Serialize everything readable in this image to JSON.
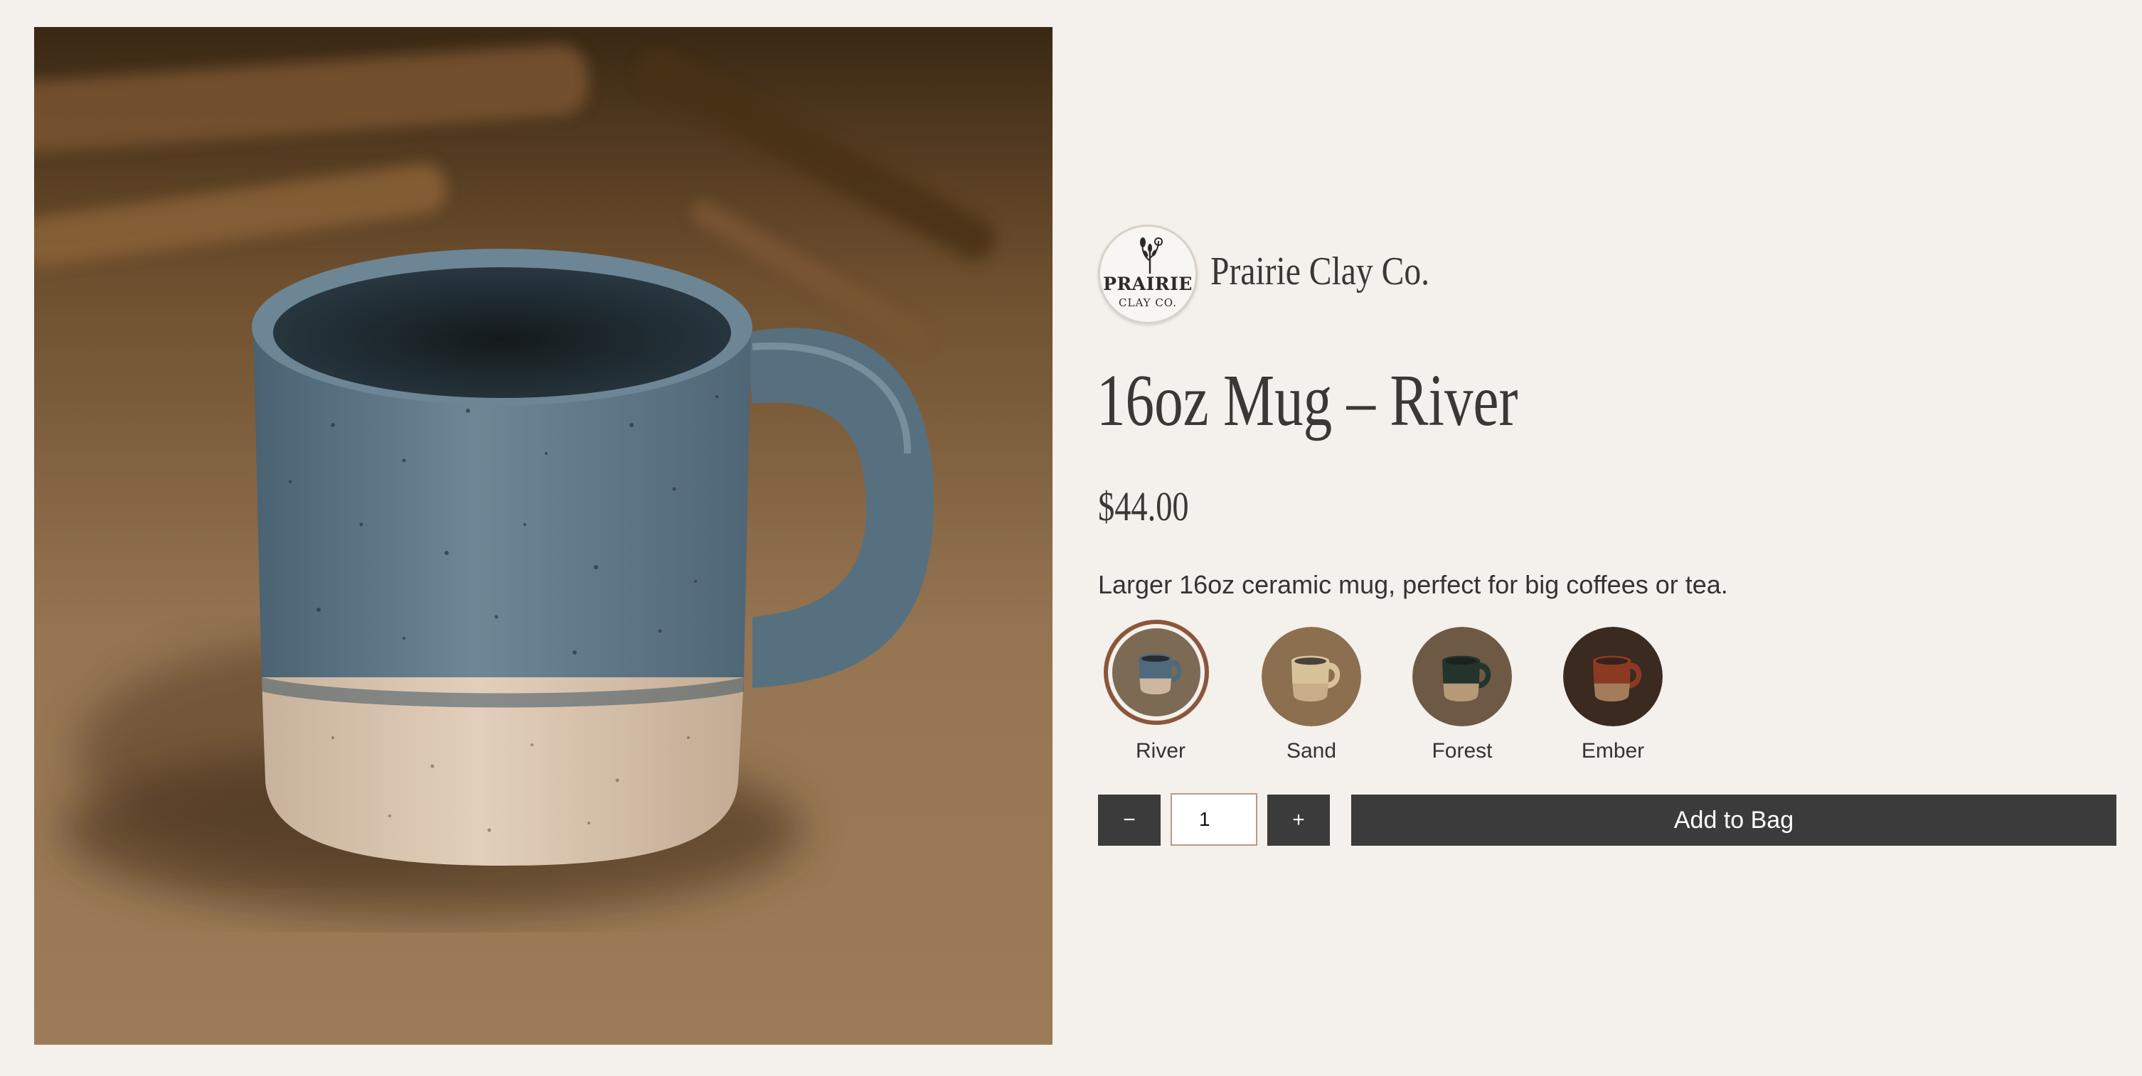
{
  "brand": {
    "logo_text": "PRAIRIE",
    "logo_subtext": "CLAY CO.",
    "name": "Prairie Clay Co."
  },
  "product": {
    "title": "16oz Mug – River",
    "price": "$44.00",
    "description": "Larger 16oz ceramic mug, perfect for big coffees or tea.",
    "image_icon": "mug-photo"
  },
  "variants": [
    {
      "label": "River",
      "selected": true,
      "glaze": "#4e6a7c",
      "clay": "#cdb7a0",
      "bg": "#7d6a55"
    },
    {
      "label": "Sand",
      "selected": false,
      "glaze": "#d8c29a",
      "clay": "#c7ad88",
      "bg": "#8c6f4e"
    },
    {
      "label": "Forest",
      "selected": false,
      "glaze": "#24342c",
      "clay": "#b59a78",
      "bg": "#6e5a44"
    },
    {
      "label": "Ember",
      "selected": false,
      "glaze": "#8a3a22",
      "clay": "#a47c5c",
      "bg": "#3a2a20"
    }
  ],
  "cart": {
    "decrement_label": "−",
    "quantity": "1",
    "increment_label": "+",
    "add_label": "Add to Bag"
  },
  "colors": {
    "background": "#f4f0eb",
    "button": "#3b3b3b",
    "selected_ring": "#8a563c",
    "text": "#333333"
  }
}
